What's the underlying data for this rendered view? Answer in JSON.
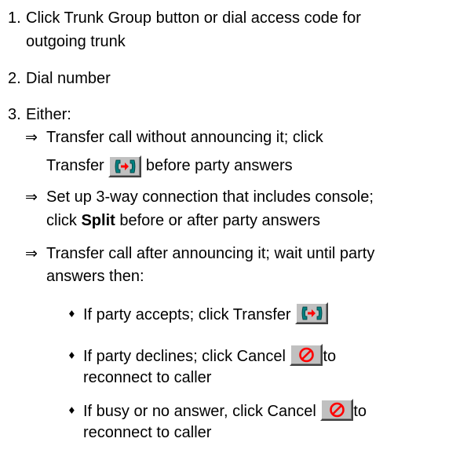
{
  "steps": [
    {
      "num": "1.",
      "line1": "Click Trunk Group button or dial access code for",
      "line2": "outgoing trunk"
    },
    {
      "num": "2.",
      "text": "Dial number"
    },
    {
      "num": "3.",
      "text": "Either:"
    }
  ],
  "arrow_symbol": "⇒",
  "diamond_symbol": "♦",
  "options": {
    "o1_line1": "Transfer call without announcing it; click",
    "o1_line2a": "Transfer",
    "o1_line2b": "before party answers",
    "o2_line1": "Set up 3-way connection that includes console;",
    "o2_line2a": "click",
    "o2_line2b": "Split",
    "o2_line2c": "before or after party answers",
    "o3_line1": "Transfer call after announcing it; wait until party",
    "o3_line2": "answers then:"
  },
  "subitems": {
    "s1": "If party accepts; click Transfer",
    "s2_line1": "If party declines; click Cancel",
    "s2_to": "to",
    "s2_line2": "reconnect to caller",
    "s3_line1": "If busy or no answer, click Cancel",
    "s3_to": "to",
    "s3_line2": "reconnect to caller"
  },
  "icons": {
    "transfer": "transfer-phone-icon",
    "cancel": "cancel-prohibit-icon"
  },
  "colors": {
    "button_face": "#c0c0c0",
    "transfer_phone": "#008080",
    "transfer_arrow": "#ff0000",
    "cancel_red": "#ff0000"
  }
}
